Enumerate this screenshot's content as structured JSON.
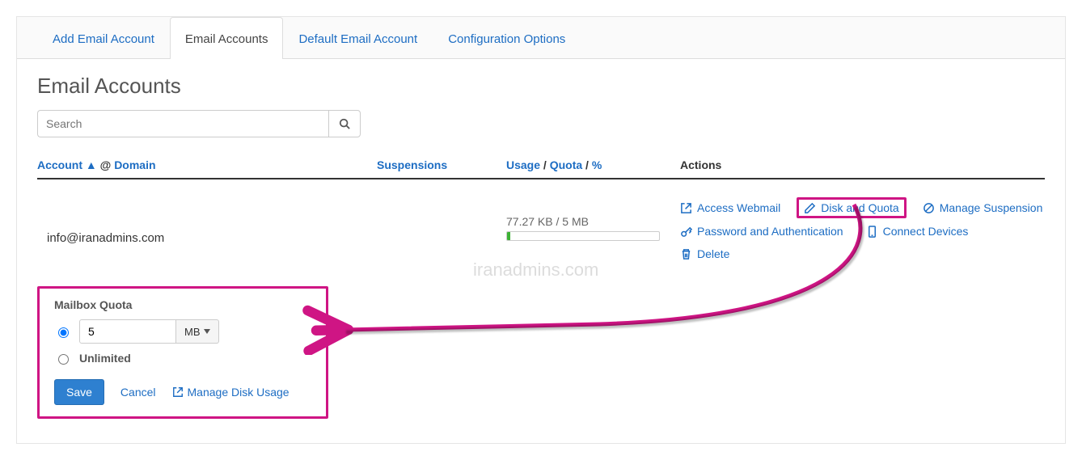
{
  "watermark": "iranadmins.com",
  "tabs": {
    "add": "Add Email Account",
    "list": "Email Accounts",
    "default": "Default Email Account",
    "config": "Configuration Options"
  },
  "page": {
    "title": "Email Accounts"
  },
  "search": {
    "placeholder": "Search"
  },
  "columns": {
    "account": "Account",
    "sort_arrow": "▲",
    "at": "@",
    "domain": "Domain",
    "suspensions": "Suspensions",
    "usage": "Usage",
    "quota": "Quota",
    "percent": "%",
    "actions": "Actions",
    "slash": "/"
  },
  "row": {
    "email": "info@iranadmins.com",
    "usage_text": "77.27 KB / 5 MB",
    "usage_percent": 2
  },
  "actions": {
    "webmail": "Access Webmail",
    "disk_quota": "Disk and Quota",
    "suspension": "Manage Suspension",
    "password": "Password and Authentication",
    "connect": "Connect Devices",
    "delete": "Delete"
  },
  "quota_panel": {
    "title": "Mailbox Quota",
    "value": "5",
    "unit": "MB",
    "unlimited": "Unlimited",
    "save": "Save",
    "cancel": "Cancel",
    "manage_disk": "Manage Disk Usage"
  }
}
